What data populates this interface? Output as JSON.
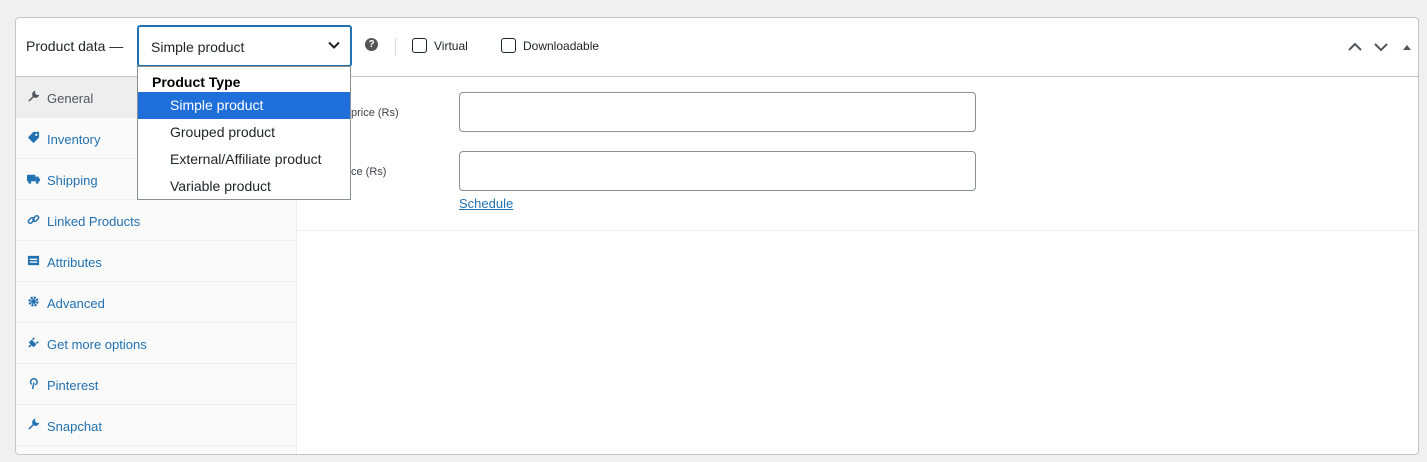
{
  "header": {
    "title": "Product data —",
    "product_type_value": "Simple product",
    "help_icon": "question-circle-icon",
    "virtual_label": "Virtual",
    "downloadable_label": "Downloadable",
    "move_up_icon": "chevron-up-icon",
    "move_down_icon": "chevron-down-icon",
    "toggle_icon": "triangle-up-icon"
  },
  "dropdown": {
    "group_label": "Product Type",
    "options": [
      {
        "label": "Simple product",
        "selected": true
      },
      {
        "label": "Grouped product",
        "selected": false
      },
      {
        "label": "External/Affiliate product",
        "selected": false
      },
      {
        "label": "Variable product",
        "selected": false
      }
    ]
  },
  "tabs": [
    {
      "label": "General",
      "icon": "wrench-icon",
      "active": true
    },
    {
      "label": "Inventory",
      "icon": "tag-icon",
      "active": false
    },
    {
      "label": "Shipping",
      "icon": "truck-icon",
      "active": false
    },
    {
      "label": "Linked Products",
      "icon": "link-icon",
      "active": false
    },
    {
      "label": "Attributes",
      "icon": "list-icon",
      "active": false
    },
    {
      "label": "Advanced",
      "icon": "gear-icon",
      "active": false
    },
    {
      "label": "Get more options",
      "icon": "plugin-icon",
      "active": false
    },
    {
      "label": "Pinterest",
      "icon": "pinterest-icon",
      "active": false
    },
    {
      "label": "Snapchat",
      "icon": "wrench-icon",
      "active": false
    }
  ],
  "general": {
    "regular_price_label": "price (Rs)",
    "sale_price_label": "ce (Rs)",
    "regular_price_value": "",
    "sale_price_value": "",
    "schedule_link": "Schedule"
  },
  "colors": {
    "accent": "#2271b1",
    "selected_option": "#1e6fd9",
    "border": "#c3c4c7"
  }
}
